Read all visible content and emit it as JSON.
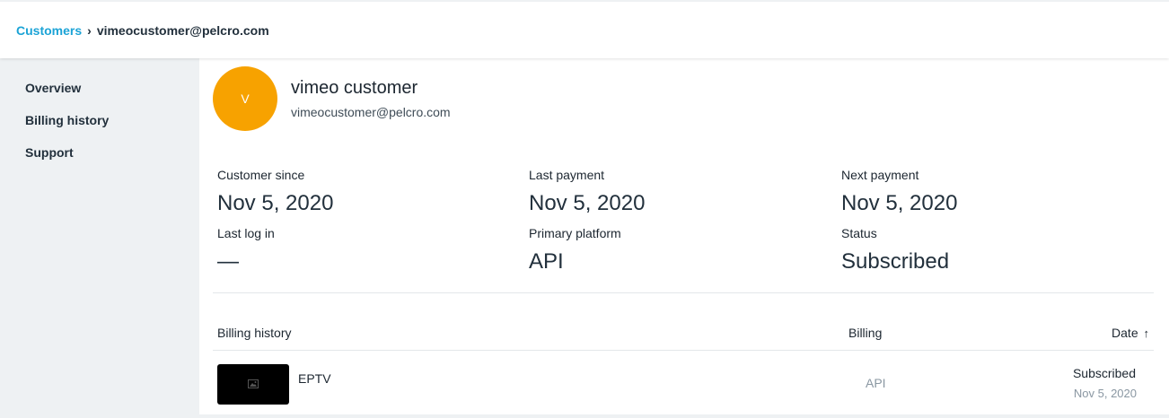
{
  "breadcrumb": {
    "parent": "Customers",
    "separator": "›",
    "current": "vimeocustomer@pelcro.com"
  },
  "sidebar": {
    "items": [
      {
        "label": "Overview"
      },
      {
        "label": "Billing history"
      },
      {
        "label": "Support"
      }
    ]
  },
  "customer": {
    "avatar_initial": "V",
    "avatar_color": "#f7a200",
    "name": "vimeo customer",
    "email": "vimeocustomer@pelcro.com"
  },
  "stats": {
    "customer_since": {
      "label": "Customer since",
      "value": "Nov 5, 2020"
    },
    "last_payment": {
      "label": "Last payment",
      "value": "Nov 5, 2020"
    },
    "next_payment": {
      "label": "Next payment",
      "value": "Nov 5, 2020"
    },
    "last_log_in": {
      "label": "Last log in",
      "value": "—"
    },
    "primary_platform": {
      "label": "Primary platform",
      "value": "API"
    },
    "status": {
      "label": "Status",
      "value": "Subscribed"
    }
  },
  "billing_table": {
    "headers": {
      "history": "Billing history",
      "billing": "Billing",
      "date": "Date",
      "date_sort_icon": "arrow-up-icon"
    },
    "rows": [
      {
        "thumbnail_icon": "image-placeholder-icon",
        "product": "EPTV",
        "billing": "API",
        "status": "Subscribed",
        "date": "Nov 5, 2020"
      }
    ]
  },
  "colors": {
    "accent": "#1ba3d6",
    "sidebar_bg": "#eef1f3",
    "muted_text": "#8a97a2"
  }
}
